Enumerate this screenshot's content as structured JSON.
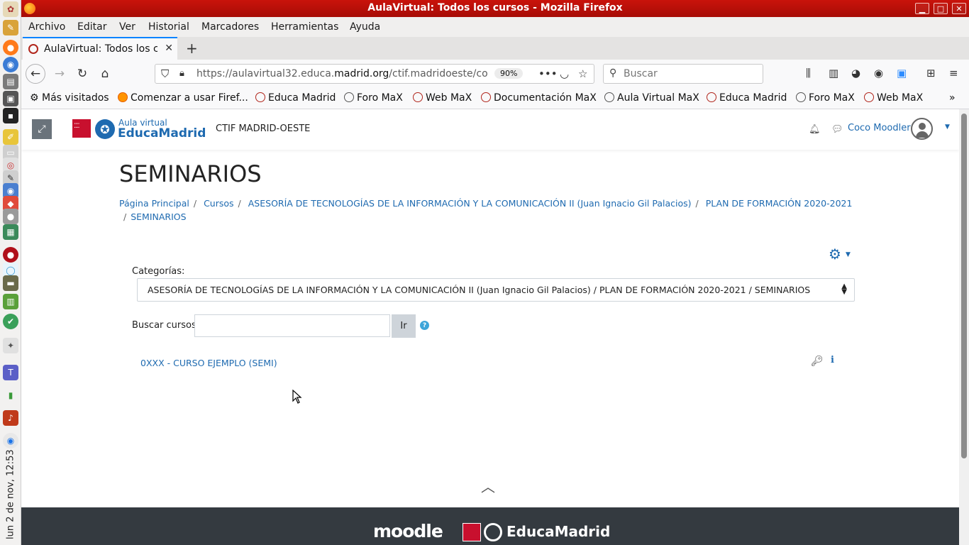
{
  "window": {
    "title": "AulaVirtual: Todos los cursos - Mozilla Firefox",
    "buttons": {
      "minimize": "▁",
      "maximize": "□",
      "close": "✕"
    }
  },
  "menu": [
    "Archivo",
    "Editar",
    "Ver",
    "Historial",
    "Marcadores",
    "Herramientas",
    "Ayuda"
  ],
  "tab": {
    "title": "AulaVirtual: Todos los cursos",
    "close": "✕",
    "new_tab": "+"
  },
  "nav": {
    "url_prefix": "https://aulavirtual32.educa.",
    "url_domain": "madrid.org",
    "url_suffix": "/ctif.madridoeste/course/index.php?categoryid=",
    "zoom": "90%",
    "search_placeholder": "Buscar"
  },
  "bookmarks": [
    "Más visitados",
    "Comenzar a usar Firef...",
    "Educa Madrid",
    "Foro MaX",
    "Web MaX",
    "Documentación MaX",
    "Aula Virtual MaX",
    "Educa Madrid",
    "Foro MaX",
    "Web MaX"
  ],
  "header": {
    "logo_small": "Aula virtual",
    "logo_big": "EducaMadrid",
    "site_name": "CTIF MADRID-OESTE",
    "user_name": "Coco Moodler"
  },
  "page": {
    "title": "SEMINARIOS",
    "breadcrumb": [
      "Página Principal",
      "Cursos",
      "ASESORÍA DE TECNOLOGÍAS DE LA INFORMACIÓN Y LA COMUNICACIÓN II (Juan Ignacio Gil Palacios)",
      "PLAN DE FORMACIÓN 2020-2021",
      "SEMINARIOS"
    ],
    "categories_label": "Categorías:",
    "category_selected": "ASESORÍA DE TECNOLOGÍAS DE LA INFORMACIÓN Y LA COMUNICACIÓN II (Juan Ignacio Gil Palacios) / PLAN DE FORMACIÓN 2020-2021 / SEMINARIOS",
    "search_label": "Buscar cursos",
    "search_button": "Ir",
    "courses": [
      "0XXX - CURSO EJEMPLO (SEMI)"
    ]
  },
  "footer": {
    "moodle": "moodle",
    "educamadrid": "EducaMadrid"
  },
  "system": {
    "clock": "lun 2 de nov, 12:53"
  },
  "colors": {
    "link": "#1e6ab0",
    "titlebar": "#b80f08",
    "footer": "#343a40"
  }
}
